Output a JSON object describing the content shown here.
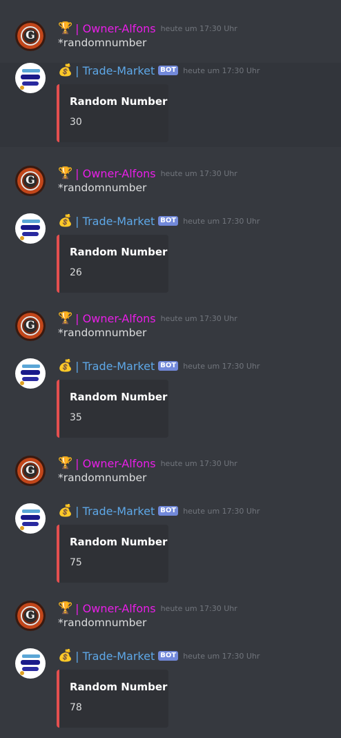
{
  "timestamp": "heute um 17:30 Uhr",
  "owner": {
    "emoji": "🏆",
    "name": "| Owner-Alfons",
    "command": "*randomnumber"
  },
  "bot": {
    "emoji": "💰",
    "name": "| Trade-Market",
    "badge": "BOT",
    "embed_title": "Random Number"
  },
  "colors": {
    "owner_name": "#e91ee8",
    "bot_name": "#5ea8e8",
    "embed_accent": "#e34f4f",
    "badge": "#7289da"
  },
  "exchanges": [
    {
      "value": "30"
    },
    {
      "value": "26"
    },
    {
      "value": "35"
    },
    {
      "value": "75"
    },
    {
      "value": "78"
    }
  ]
}
